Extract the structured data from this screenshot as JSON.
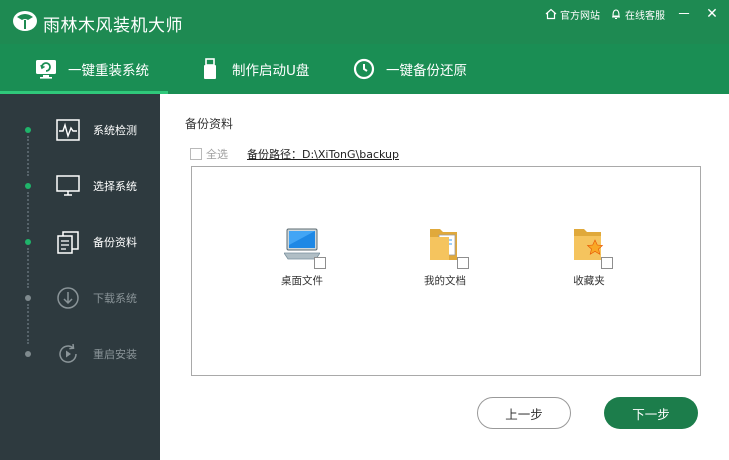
{
  "app": {
    "title": "雨林木风装机大师"
  },
  "titlebar": {
    "official_site": "官方网站",
    "online_service": "在线客服",
    "minimize": "－",
    "close": "✕"
  },
  "tabs": [
    {
      "label": "一键重装系统",
      "active": true
    },
    {
      "label": "制作启动U盘",
      "active": false
    },
    {
      "label": "一键备份还原",
      "active": false
    }
  ],
  "sidebar": {
    "steps": [
      {
        "label": "系统检测",
        "icon": "heartbeat-monitor-icon",
        "active": true
      },
      {
        "label": "选择系统",
        "icon": "monitor-icon",
        "active": true
      },
      {
        "label": "备份资料",
        "icon": "copy-documents-icon",
        "active": true
      },
      {
        "label": "下载系统",
        "icon": "download-icon",
        "active": false
      },
      {
        "label": "重启安装",
        "icon": "restart-icon",
        "active": false
      }
    ]
  },
  "main": {
    "section_title": "备份资料",
    "select_all": "全选",
    "backup_path": "备份路径：D:\\XiTonG\\backup",
    "items": [
      {
        "label": "桌面文件",
        "icon": "desktop-computer-icon",
        "checked": false
      },
      {
        "label": "我的文档",
        "icon": "documents-folder-icon",
        "checked": false
      },
      {
        "label": "收藏夹",
        "icon": "favorites-folder-icon",
        "checked": false
      }
    ],
    "prev_button": "上一步",
    "next_button": "下一步"
  },
  "colors": {
    "brand_green": "#1e8a52",
    "sidebar_bg": "#2e3a3f",
    "active_dot": "#1fb46a",
    "next_button": "#1c7d4b"
  }
}
